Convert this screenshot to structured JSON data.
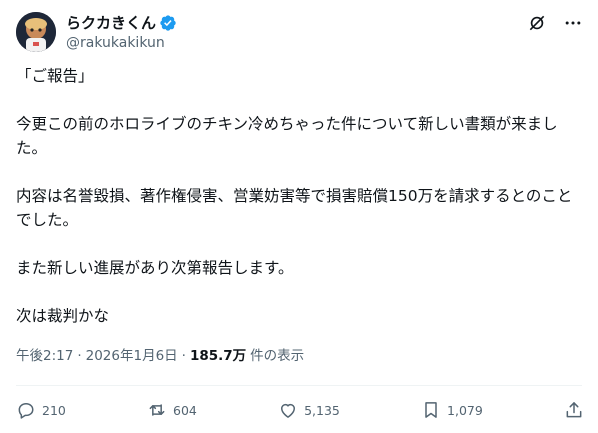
{
  "author": {
    "display_name": "らクカきくん",
    "handle": "@rakukakikun",
    "verified": true
  },
  "tweet": {
    "paragraphs": [
      "「ご報告」",
      "今更この前のホロライブのチキン冷めちゃった件について新しい書類が来ました。",
      "内容は名誉毀損、著作権侵害、営業妨害等で損害賠償150万を請求するとのことでした。",
      "また新しい進展があり次第報告します。",
      "次は裁判かな"
    ]
  },
  "meta": {
    "time": "午後2:17",
    "separator": "·",
    "date": "2026年1月6日",
    "views_count": "185.7万",
    "views_label": "件の表示"
  },
  "actions": {
    "replies": "210",
    "reposts": "604",
    "likes": "5,135",
    "bookmarks": "1,079"
  },
  "colors": {
    "text": "#0f1419",
    "secondary": "#536471",
    "verified": "#1d9bf0",
    "divider": "#eff3f4"
  },
  "icons": [
    "grok-icon",
    "more-icon",
    "reply-icon",
    "repost-icon",
    "like-icon",
    "bookmark-icon",
    "share-icon",
    "verified-icon"
  ]
}
